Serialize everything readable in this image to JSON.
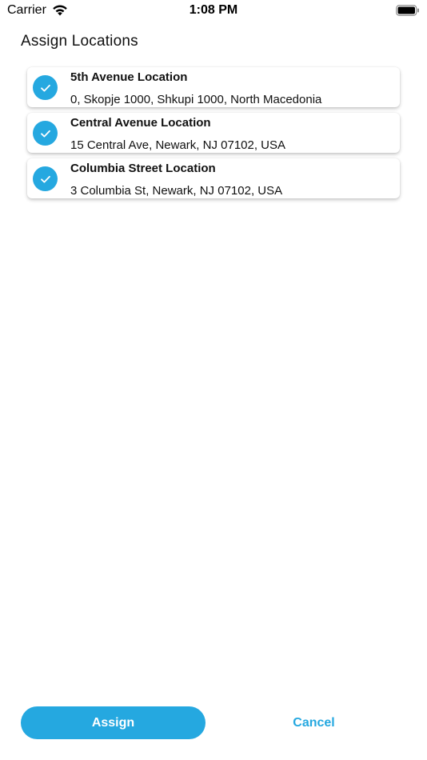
{
  "status_bar": {
    "carrier": "Carrier",
    "time": "1:08 PM"
  },
  "header": {
    "title": "Assign Locations"
  },
  "locations": [
    {
      "name": "5th Avenue Location",
      "address": "0, Skopje 1000, Shkupi 1000, North Macedonia",
      "checked": true
    },
    {
      "name": "Central Avenue Location",
      "address": "15 Central Ave, Newark, NJ 07102, USA",
      "checked": true
    },
    {
      "name": "Columbia Street Location",
      "address": "3 Columbia St, Newark, NJ 07102, USA",
      "checked": true
    }
  ],
  "actions": {
    "assign_label": "Assign",
    "cancel_label": "Cancel"
  },
  "colors": {
    "accent": "#25a8e0",
    "card_background": "#ffffff",
    "text": "#111111"
  },
  "icons": {
    "check": "check-icon",
    "wifi": "wifi-icon",
    "battery": "battery-icon"
  }
}
